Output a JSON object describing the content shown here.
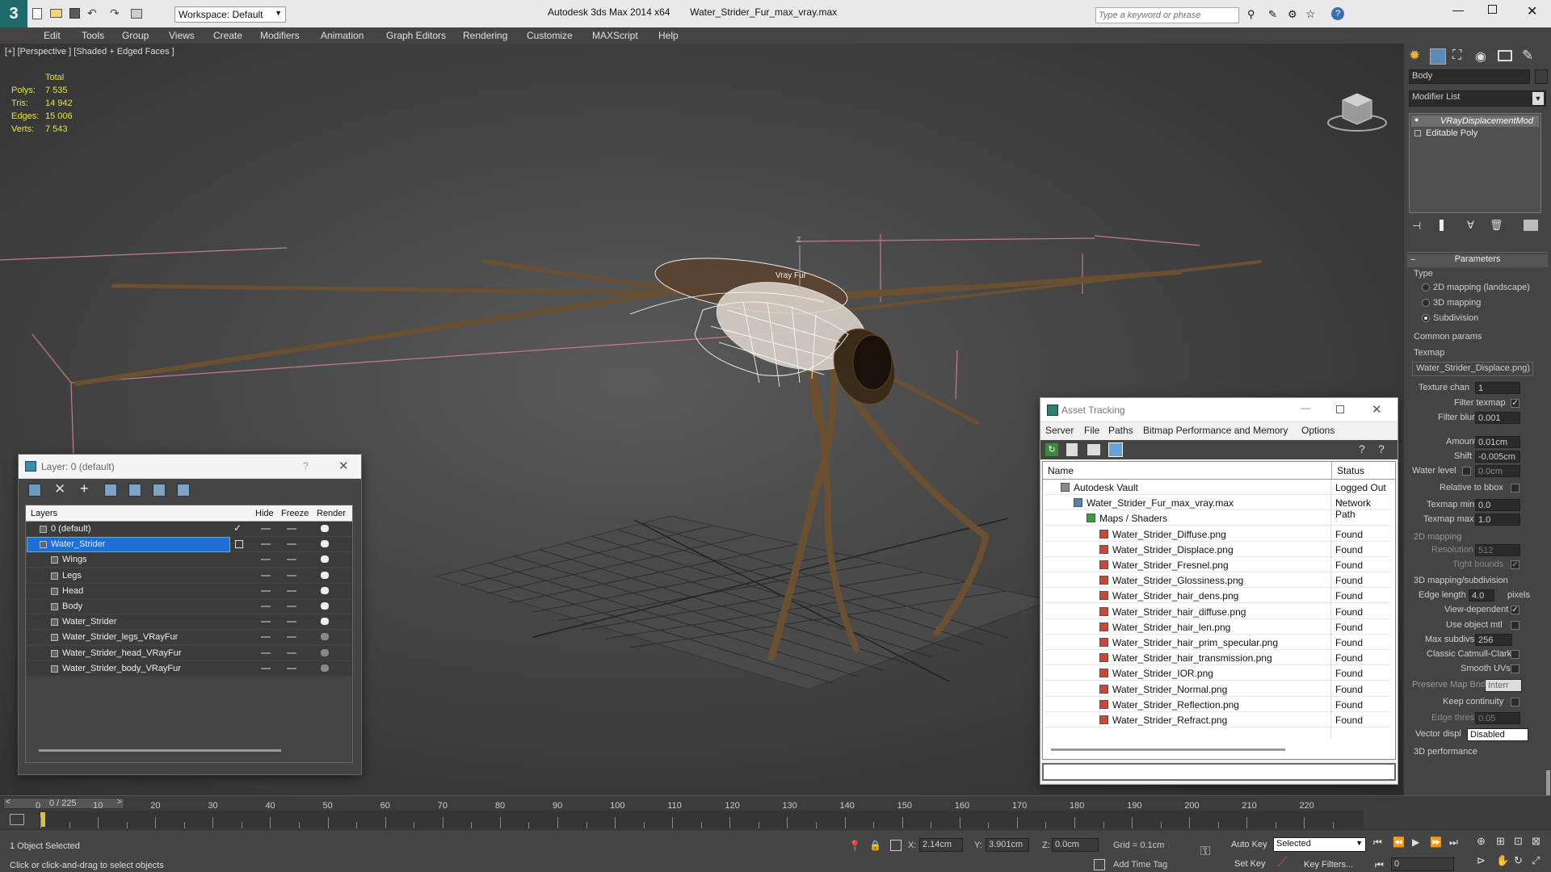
{
  "title": {
    "app": "Autodesk 3ds Max  2014 x64",
    "file": "Water_Strider_Fur_max_vray.max",
    "workspace": "Workspace: Default",
    "search_placeholder": "Type a keyword or phrase"
  },
  "menu": [
    "Edit",
    "Tools",
    "Group",
    "Views",
    "Create",
    "Modifiers",
    "Animation",
    "Graph Editors",
    "Rendering",
    "Customize",
    "MAXScript",
    "Help"
  ],
  "viewport": {
    "label": "[+] [Perspective ] [Shaded + Edged Faces ]",
    "stats": {
      "header": "Total",
      "rows": [
        {
          "k": "Polys:",
          "v": "7 535"
        },
        {
          "k": "Tris:",
          "v": "14 942"
        },
        {
          "k": "Edges:",
          "v": "15 006"
        },
        {
          "k": "Verts:",
          "v": "7 543"
        }
      ]
    },
    "gizmo_label": "Z",
    "object_label": "Vray Fur"
  },
  "layer_window": {
    "title": "Layer: 0 (default)",
    "help": "?",
    "columns": {
      "layers": "Layers",
      "hide": "Hide",
      "freeze": "Freeze",
      "render": "Render"
    },
    "rows": [
      {
        "name": "0 (default)",
        "level": 0,
        "current": true
      },
      {
        "name": "Water_Strider",
        "level": 0,
        "selected": true
      },
      {
        "name": "Wings",
        "level": 1
      },
      {
        "name": "Legs",
        "level": 1
      },
      {
        "name": "Head",
        "level": 1
      },
      {
        "name": "Body",
        "level": 1
      },
      {
        "name": "Water_Strider",
        "level": 1
      },
      {
        "name": "Water_Strider_legs_VRayFur",
        "level": 1
      },
      {
        "name": "Water_Strider_head_VRayFur",
        "level": 1
      },
      {
        "name": "Water_Strider_body_VRayFur",
        "level": 1
      }
    ]
  },
  "asset_window": {
    "title": "Asset Tracking",
    "menu": [
      "Server",
      "File",
      "Paths",
      "Bitmap Performance and Memory",
      "Options"
    ],
    "columns": {
      "name": "Name",
      "status": "Status"
    },
    "rows": [
      {
        "name": "Autodesk Vault",
        "status": "Logged Out ...",
        "level": 0,
        "kind": "vault"
      },
      {
        "name": "Water_Strider_Fur_max_vray.max",
        "status": "Network Path",
        "level": 1,
        "kind": "max"
      },
      {
        "name": "Maps / Shaders",
        "status": "",
        "level": 2,
        "kind": "folder"
      },
      {
        "name": "Water_Strider_Diffuse.png",
        "status": "Found",
        "level": 3,
        "kind": "png"
      },
      {
        "name": "Water_Strider_Displace.png",
        "status": "Found",
        "level": 3,
        "kind": "png"
      },
      {
        "name": "Water_Strider_Fresnel.png",
        "status": "Found",
        "level": 3,
        "kind": "png"
      },
      {
        "name": "Water_Strider_Glossiness.png",
        "status": "Found",
        "level": 3,
        "kind": "png"
      },
      {
        "name": "Water_Strider_hair_dens.png",
        "status": "Found",
        "level": 3,
        "kind": "png"
      },
      {
        "name": "Water_Strider_hair_diffuse.png",
        "status": "Found",
        "level": 3,
        "kind": "png"
      },
      {
        "name": "Water_Strider_hair_len.png",
        "status": "Found",
        "level": 3,
        "kind": "png"
      },
      {
        "name": "Water_Strider_hair_prim_specular.png",
        "status": "Found",
        "level": 3,
        "kind": "png"
      },
      {
        "name": "Water_Strider_hair_transmission.png",
        "status": "Found",
        "level": 3,
        "kind": "png"
      },
      {
        "name": "Water_Strider_IOR.png",
        "status": "Found",
        "level": 3,
        "kind": "png"
      },
      {
        "name": "Water_Strider_Normal.png",
        "status": "Found",
        "level": 3,
        "kind": "png"
      },
      {
        "name": "Water_Strider_Reflection.png",
        "status": "Found",
        "level": 3,
        "kind": "png"
      },
      {
        "name": "Water_Strider_Refract.png",
        "status": "Found",
        "level": 3,
        "kind": "png"
      }
    ]
  },
  "command_panel": {
    "object_name": "Body",
    "modifier_list": "Modifier List",
    "stack": [
      "VRayDisplacementMod",
      "Editable Poly"
    ],
    "rollout_title": "Parameters",
    "type_label": "Type",
    "type_options": [
      "2D mapping (landscape)",
      "3D mapping",
      "Subdivision"
    ],
    "type_selected": 2,
    "common_params": "Common params",
    "texmap_label": "Texmap",
    "texmap_value": "Water_Strider_Displace.png)",
    "texture_chan": {
      "label": "Texture chan",
      "value": "1"
    },
    "filter_texmap": {
      "label": "Filter texmap",
      "checked": true
    },
    "filter_blur": {
      "label": "Filter blur",
      "value": "0.001"
    },
    "amount": {
      "label": "Amount",
      "value": "0.01cm"
    },
    "shift": {
      "label": "Shift",
      "value": "-0.005cm"
    },
    "water_level": {
      "label": "Water level",
      "value": "0.0cm"
    },
    "relative_bbox": "Relative to bbox",
    "texmap_min": {
      "label": "Texmap min",
      "value": "0.0"
    },
    "texmap_max": {
      "label": "Texmap max",
      "value": "1.0"
    },
    "mapping_2d": "2D mapping",
    "resolution": {
      "label": "Resolution",
      "value": "512"
    },
    "tight_bounds": "Tight bounds",
    "mapping_3d": "3D mapping/subdivision",
    "edge_length": {
      "label": "Edge length",
      "value": "4.0",
      "unit": "pixels"
    },
    "view_dependent": "View-dependent",
    "use_object_mtl": "Use object mtl",
    "max_subdivs": {
      "label": "Max subdivs",
      "value": "256"
    },
    "classic_catmull": "Classic Catmull-Clark",
    "smooth_uvs": "Smooth UVs",
    "preserve_map": {
      "label": "Preserve Map Bnd",
      "value": "Interr"
    },
    "keep_continuity": "Keep continuity",
    "edge_thresh": {
      "label": "Edge thresh",
      "value": "0.05"
    },
    "vector_displ": {
      "label": "Vector displ",
      "value": "Disabled"
    },
    "performance": "3D performance"
  },
  "timeline": {
    "frame_label": "0 / 225",
    "ticks": [
      "0",
      "10",
      "20",
      "30",
      "40",
      "50",
      "60",
      "70",
      "80",
      "90",
      "100",
      "110",
      "120",
      "130",
      "140",
      "150",
      "160",
      "170",
      "180",
      "190",
      "200",
      "210",
      "220"
    ]
  },
  "status_bar": {
    "selection": "1 Object Selected",
    "prompt": "Click or click-and-drag to select objects",
    "x_label": "X:",
    "x_value": "2.14cm",
    "y_label": "Y:",
    "y_value": "3.901cm",
    "z_label": "Z:",
    "z_value": "0.0cm",
    "grid": "Grid = 0.1cm",
    "add_time_tag": "Add Time Tag",
    "auto_key": "Auto Key",
    "selected": "Selected",
    "set_key": "Set Key",
    "key_filters": "Key Filters...",
    "frame": "0"
  }
}
